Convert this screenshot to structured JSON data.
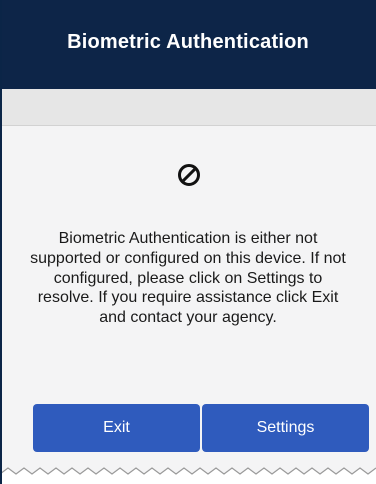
{
  "header": {
    "title": "Biometric Authentication"
  },
  "dialog": {
    "icon": "blocked-circle-icon",
    "message": "Biometric Authentication is either not supported or configured on this device. If not configured, please click on Settings to resolve. If you require assistance click Exit and contact your agency."
  },
  "buttons": {
    "exit_label": "Exit",
    "settings_label": "Settings"
  },
  "colors": {
    "header_bg": "#0d2548",
    "button_bg": "#2f5bbd",
    "subbar_bg": "#e6e6e6",
    "content_bg": "#f4f4f5"
  }
}
